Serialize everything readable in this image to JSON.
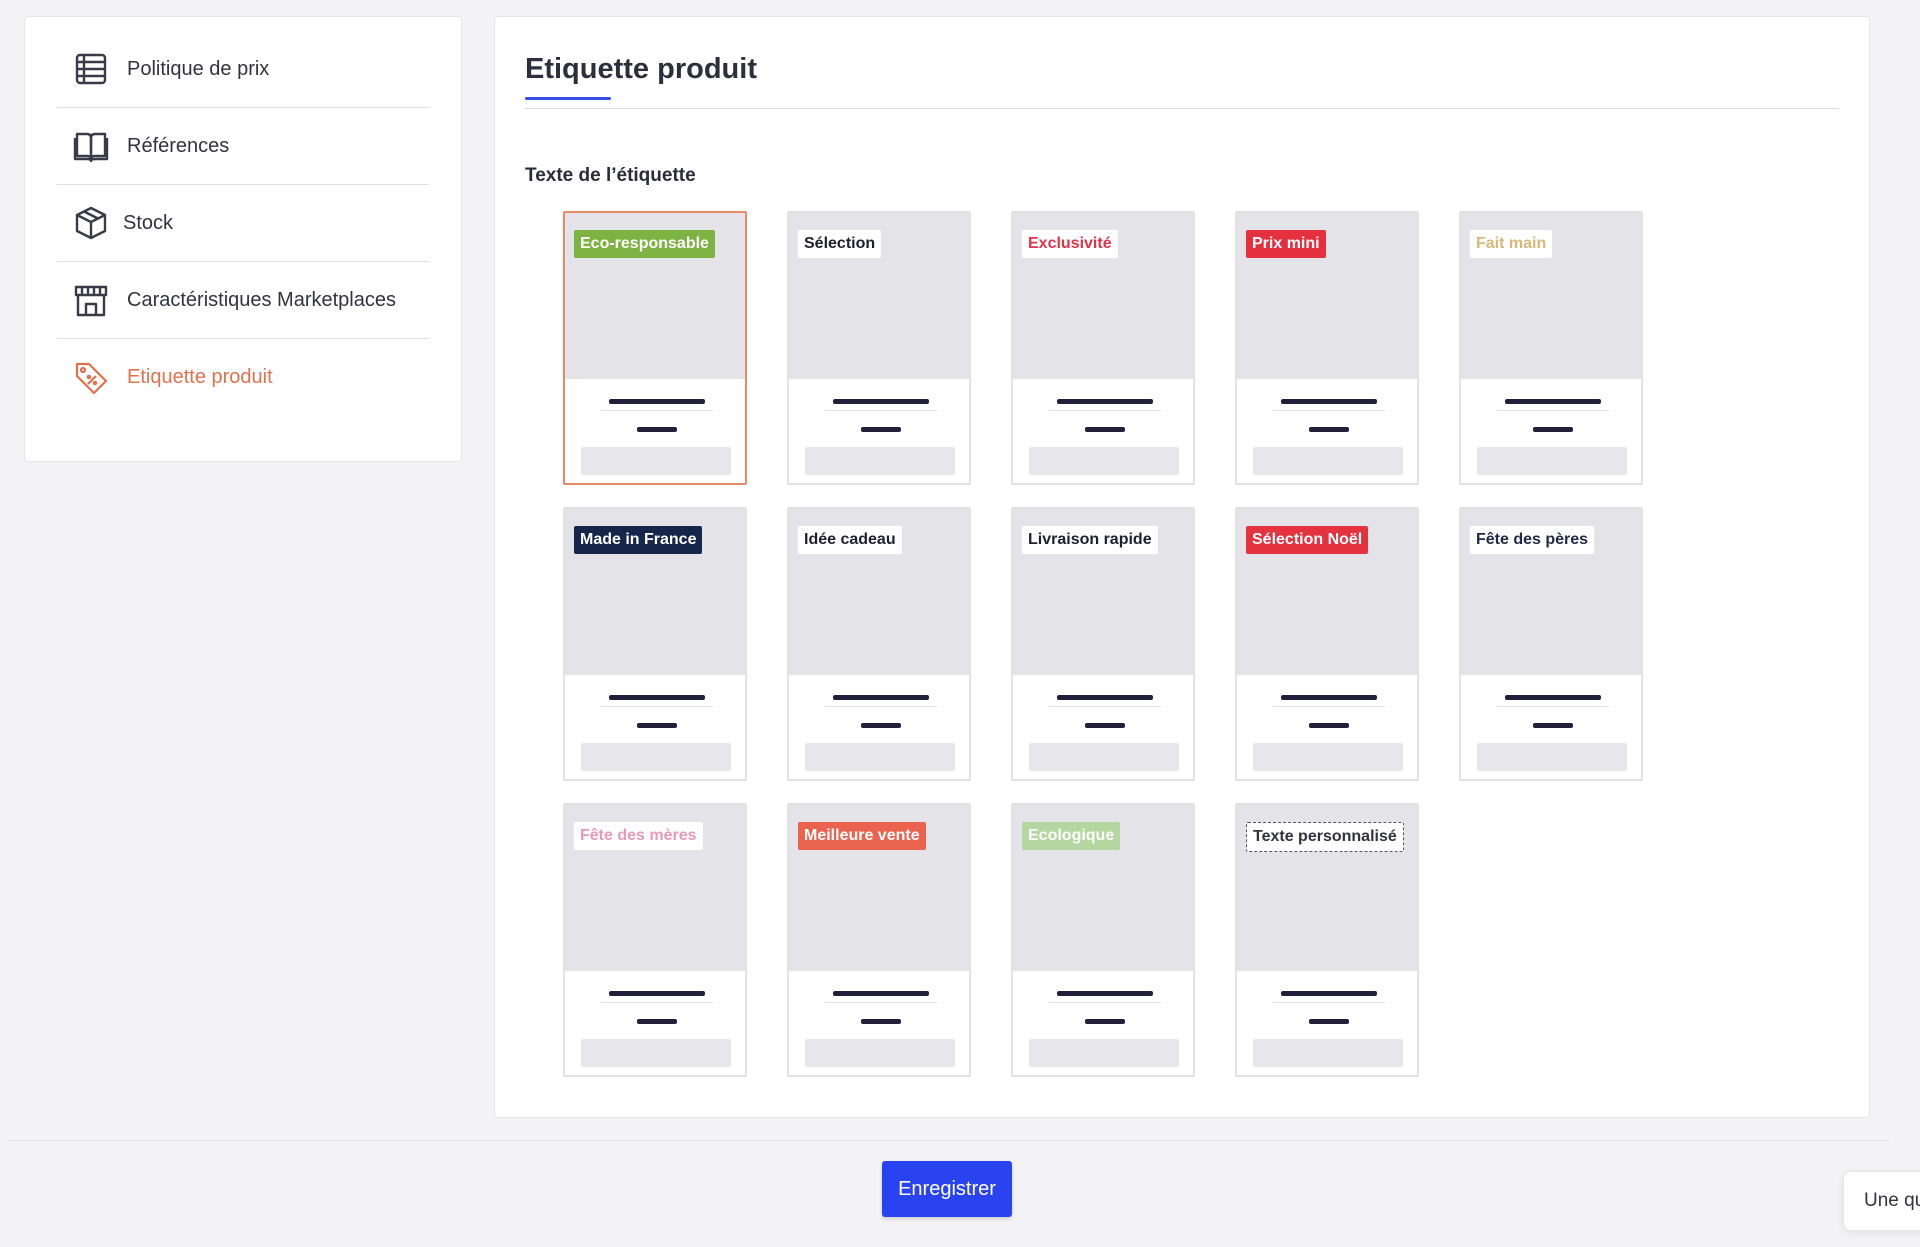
{
  "sidebar": {
    "items": [
      {
        "label": "Politique de prix",
        "icon": "database-icon",
        "active": false
      },
      {
        "label": "Références",
        "icon": "open-book-icon",
        "active": false
      },
      {
        "label": "Stock",
        "icon": "box-icon",
        "active": false
      },
      {
        "label": "Caractéristiques Marketplaces",
        "icon": "storefront-icon",
        "active": false
      },
      {
        "label": "Etiquette produit",
        "icon": "tag-icon",
        "active": true
      }
    ]
  },
  "main": {
    "title": "Etiquette produit",
    "section_label": "Texte de l’étiquette",
    "selected_label": "Eco-responsable",
    "labels": [
      {
        "text": "Eco-responsable",
        "bg": "#7cb342",
        "color": "#ffffff",
        "selected": true
      },
      {
        "text": "Sélection",
        "bg": "#ffffff",
        "color": "#1f1f2e"
      },
      {
        "text": "Exclusivité",
        "bg": "#ffffff",
        "color": "#e0344a"
      },
      {
        "text": "Prix mini",
        "bg": "#e53040",
        "color": "#ffffff"
      },
      {
        "text": "Fait main",
        "bg": "#ffffff",
        "color": "#d8b87a"
      },
      {
        "text": "Made in France",
        "bg": "#16264a",
        "color": "#ffffff"
      },
      {
        "text": "Idée cadeau",
        "bg": "#ffffff",
        "color": "#1f1f2e"
      },
      {
        "text": "Livraison rapide",
        "bg": "#ffffff",
        "color": "#1f1f2e"
      },
      {
        "text": "Sélection Noël",
        "bg": "#e5323f",
        "color": "#ffffff"
      },
      {
        "text": "Fête des pères",
        "bg": "#ffffff",
        "color": "#1e2a48"
      },
      {
        "text": "Fête des mères",
        "bg": "#ffffff",
        "color": "#e69ab8"
      },
      {
        "text": "Meilleure vente",
        "bg": "#e9634e",
        "color": "#ffffff"
      },
      {
        "text": "Ecologique",
        "bg": "#b4d6a0",
        "color": "#ffffff"
      },
      {
        "text": "Texte personnalisé",
        "bg": "#ffffff",
        "color": "#33333f",
        "dashed": true
      }
    ]
  },
  "footer": {
    "save_label": "Enregistrer",
    "chat_text": "Une qu"
  },
  "colors": {
    "accent": "#2a43f0",
    "active_nav": "#e0724e"
  }
}
